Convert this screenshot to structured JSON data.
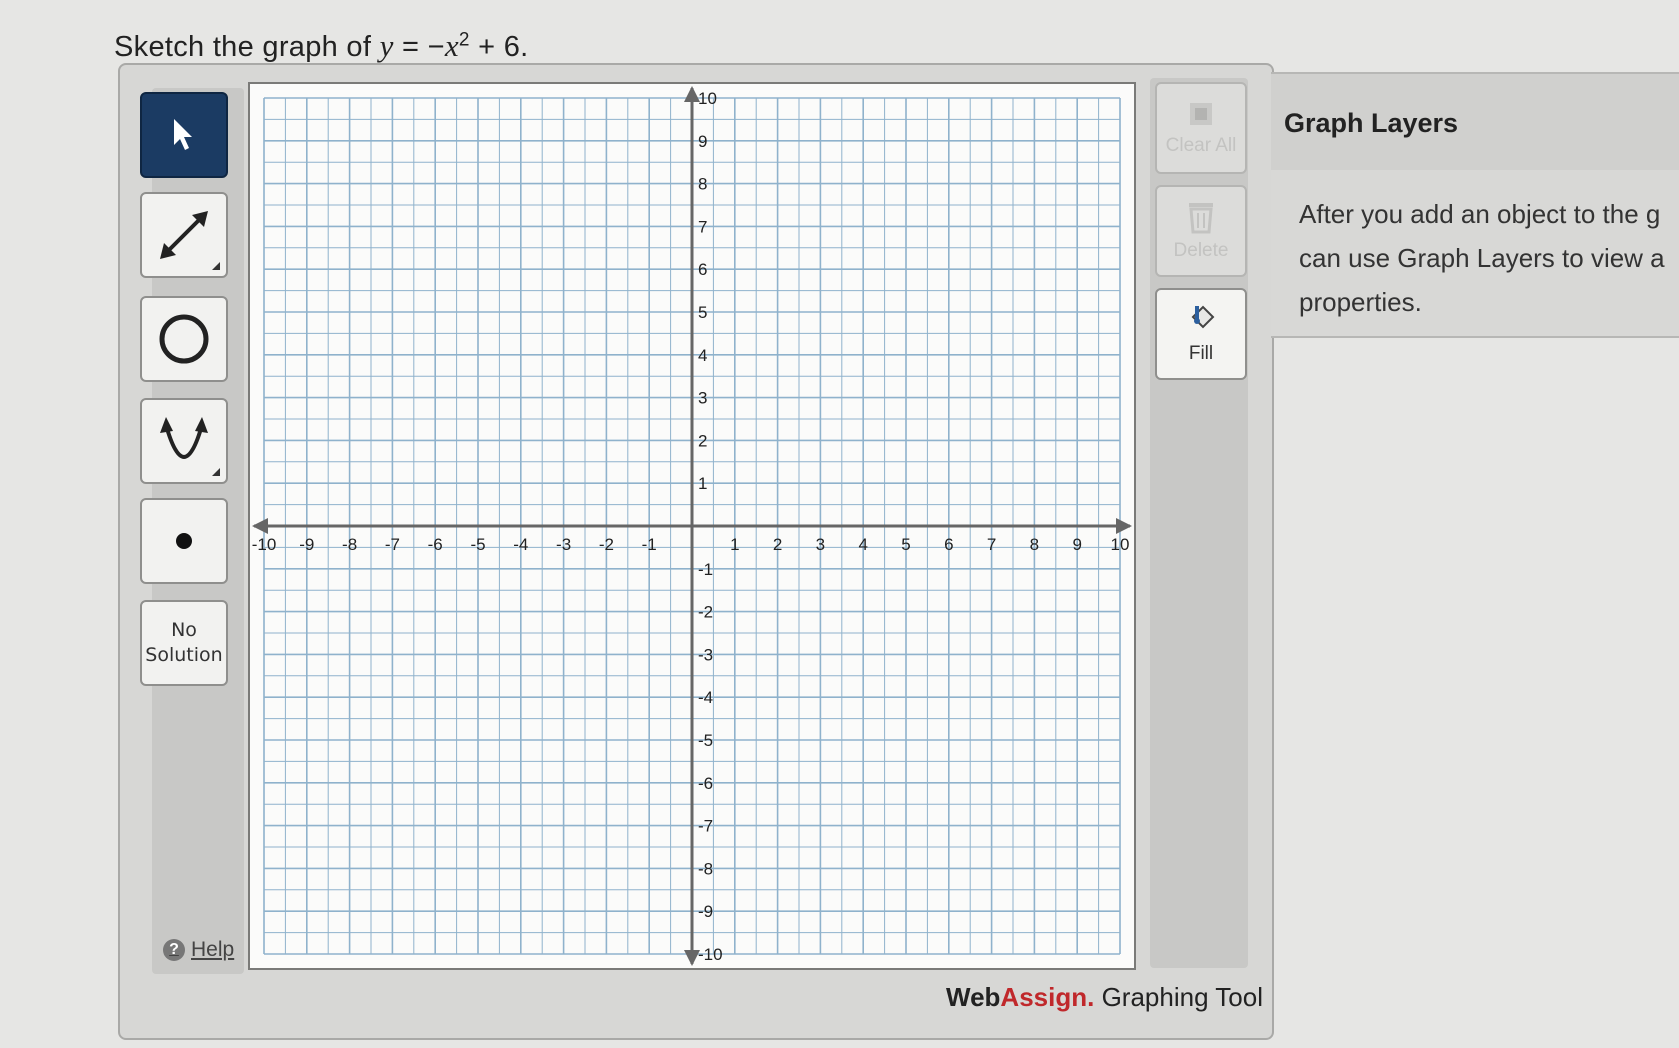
{
  "question": {
    "prefix": "Sketch the graph of",
    "var_y": "y",
    "eq": "= −",
    "var_x": "x",
    "exp": "2",
    "suffix": "+ 6."
  },
  "toolbar": {
    "tools": [
      {
        "name": "select-tool",
        "icon": "arrow-pointer-icon",
        "active": true
      },
      {
        "name": "line-tool",
        "icon": "double-arrow-line-icon",
        "active": false
      },
      {
        "name": "circle-tool",
        "icon": "circle-icon",
        "active": false
      },
      {
        "name": "parabola-tool",
        "icon": "parabola-icon",
        "active": false
      },
      {
        "name": "point-tool",
        "icon": "point-icon",
        "active": false
      }
    ],
    "no_solution_line1": "No",
    "no_solution_line2": "Solution",
    "help_label": "Help"
  },
  "actions": {
    "clear_all_label": "Clear All",
    "delete_label": "Delete",
    "fill_label": "Fill"
  },
  "graph": {
    "x_min": -10,
    "x_max": 10,
    "y_min": -10,
    "y_max": 10,
    "grid_step": 0.5,
    "x_tick_labels": [
      "-10",
      "-9",
      "-8",
      "-7",
      "-6",
      "-5",
      "-4",
      "-3",
      "-2",
      "-1",
      "1",
      "2",
      "3",
      "4",
      "5",
      "6",
      "7",
      "8",
      "9",
      "10"
    ],
    "y_tick_labels": [
      "10",
      "9",
      "8",
      "7",
      "6",
      "5",
      "4",
      "3",
      "2",
      "1",
      "-1",
      "-2",
      "-3",
      "-4",
      "-5",
      "-6",
      "-7",
      "-8",
      "-9",
      "-10"
    ],
    "grid_color": "#8fb2cc",
    "axis_color": "#666666"
  },
  "brand": {
    "web": "Web",
    "assign": "Assign.",
    "rest": "Graphing Tool",
    "accent_color": "#c0282b"
  },
  "layers": {
    "title": "Graph Layers",
    "body": "After you add an object to the g\ncan use Graph Layers to view a\nproperties."
  }
}
